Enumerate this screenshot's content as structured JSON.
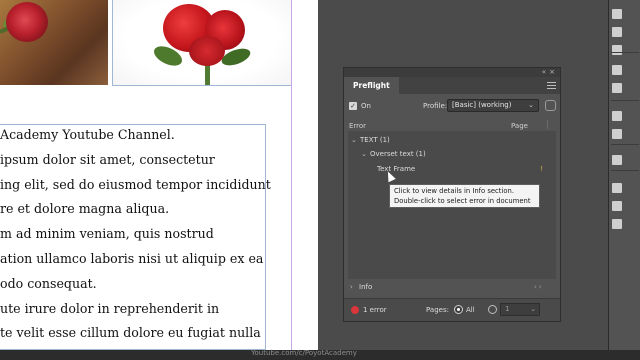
{
  "document": {
    "body_lines": [
      "Academy Youtube Channel.",
      "ipsum dolor sit amet, consectetur",
      "ing elit, sed do eiusmod tempor incididunt",
      "re et dolore magna aliqua.",
      "m ad minim veniam, quis nostrud",
      "ation ullamco laboris nisi ut aliquip ex ea",
      "odo consequat.",
      "ute irure dolor in reprehenderit in",
      "te velit esse cillum dolore eu fugiat nulla"
    ]
  },
  "preflight": {
    "title": "Preflight",
    "on_label": "On",
    "on_checked": true,
    "profile_label": "Profile:",
    "profile_value": "[Basic] (working)",
    "columns": {
      "error": "Error",
      "page": "Page"
    },
    "tree": {
      "group": "TEXT (1)",
      "subgroup": "Overset text (1)",
      "item": "Text Frame",
      "item_page_marker": "!"
    },
    "tooltip": {
      "line1": "Click to view details in Info section.",
      "line2": "Double-click to select error in document"
    },
    "info_label": "Info",
    "footer": {
      "error_count": "1 error",
      "pages_label": "Pages:",
      "all_label": "All",
      "range_value": "1"
    },
    "colors": {
      "error_dot": "#d9363b",
      "panel_bg": "#535353"
    }
  },
  "watermark": "Youtube.com/c/PoyotAcademy",
  "dock_icons": [
    "pages-icon",
    "layers-icon",
    "links-icon",
    "stroke-icon",
    "color-icon",
    "swatches-icon",
    "text-wrap-icon",
    "table-icon",
    "styles-icon",
    "gradient-icon"
  ]
}
